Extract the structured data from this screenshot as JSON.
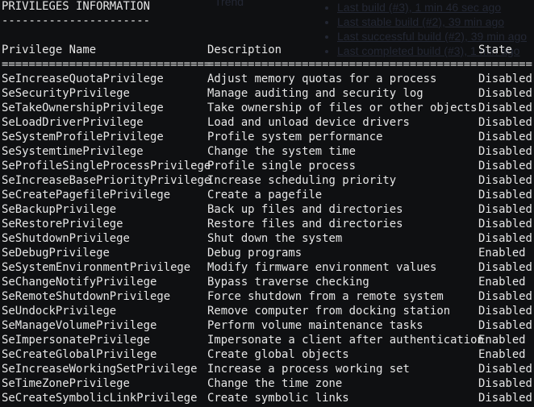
{
  "title": "PRIVILEGES INFORMATION",
  "title_rule": "----------------------",
  "headers": {
    "name": "Privilege Name",
    "description": "Description",
    "state": "State"
  },
  "separators": {
    "name": "===============================",
    "description": "=========================================",
    "state": "========"
  },
  "background_ghost": {
    "trend": "Trend",
    "links": [
      "Last build (#3), 1 min 46 sec ago",
      "Last stable build (#2), 39 min ago",
      "Last successful build (#2), 39 min ago",
      "Last completed build (#3), 1 min ago"
    ]
  },
  "rows": [
    {
      "name": "SeIncreaseQuotaPrivilege",
      "description": "Adjust memory quotas for a process",
      "state": "Disabled"
    },
    {
      "name": "SeSecurityPrivilege",
      "description": "Manage auditing and security log",
      "state": "Disabled"
    },
    {
      "name": "SeTakeOwnershipPrivilege",
      "description": "Take ownership of files or other objects",
      "state": "Disabled"
    },
    {
      "name": "SeLoadDriverPrivilege",
      "description": "Load and unload device drivers",
      "state": "Disabled"
    },
    {
      "name": "SeSystemProfilePrivilege",
      "description": "Profile system performance",
      "state": "Disabled"
    },
    {
      "name": "SeSystemtimePrivilege",
      "description": "Change the system time",
      "state": "Disabled"
    },
    {
      "name": "SeProfileSingleProcessPrivilege",
      "description": "Profile single process",
      "state": "Disabled"
    },
    {
      "name": "SeIncreaseBasePriorityPrivilege",
      "description": "Increase scheduling priority",
      "state": "Disabled"
    },
    {
      "name": "SeCreatePagefilePrivilege",
      "description": "Create a pagefile",
      "state": "Disabled"
    },
    {
      "name": "SeBackupPrivilege",
      "description": "Back up files and directories",
      "state": "Disabled"
    },
    {
      "name": "SeRestorePrivilege",
      "description": "Restore files and directories",
      "state": "Disabled"
    },
    {
      "name": "SeShutdownPrivilege",
      "description": "Shut down the system",
      "state": "Disabled"
    },
    {
      "name": "SeDebugPrivilege",
      "description": "Debug programs",
      "state": "Enabled"
    },
    {
      "name": "SeSystemEnvironmentPrivilege",
      "description": "Modify firmware environment values",
      "state": "Disabled"
    },
    {
      "name": "SeChangeNotifyPrivilege",
      "description": "Bypass traverse checking",
      "state": "Enabled"
    },
    {
      "name": "SeRemoteShutdownPrivilege",
      "description": "Force shutdown from a remote system",
      "state": "Disabled"
    },
    {
      "name": "SeUndockPrivilege",
      "description": "Remove computer from docking station",
      "state": "Disabled"
    },
    {
      "name": "SeManageVolumePrivilege",
      "description": "Perform volume maintenance tasks",
      "state": "Disabled"
    },
    {
      "name": "SeImpersonatePrivilege",
      "description": "Impersonate a client after authentication",
      "state": "Enabled"
    },
    {
      "name": "SeCreateGlobalPrivilege",
      "description": "Create global objects",
      "state": "Enabled"
    },
    {
      "name": "SeIncreaseWorkingSetPrivilege",
      "description": "Increase a process working set",
      "state": "Disabled"
    },
    {
      "name": "SeTimeZonePrivilege",
      "description": "Change the time zone",
      "state": "Disabled"
    },
    {
      "name": "SeCreateSymbolicLinkPrivilege",
      "description": "Create symbolic links",
      "state": "Disabled"
    }
  ]
}
